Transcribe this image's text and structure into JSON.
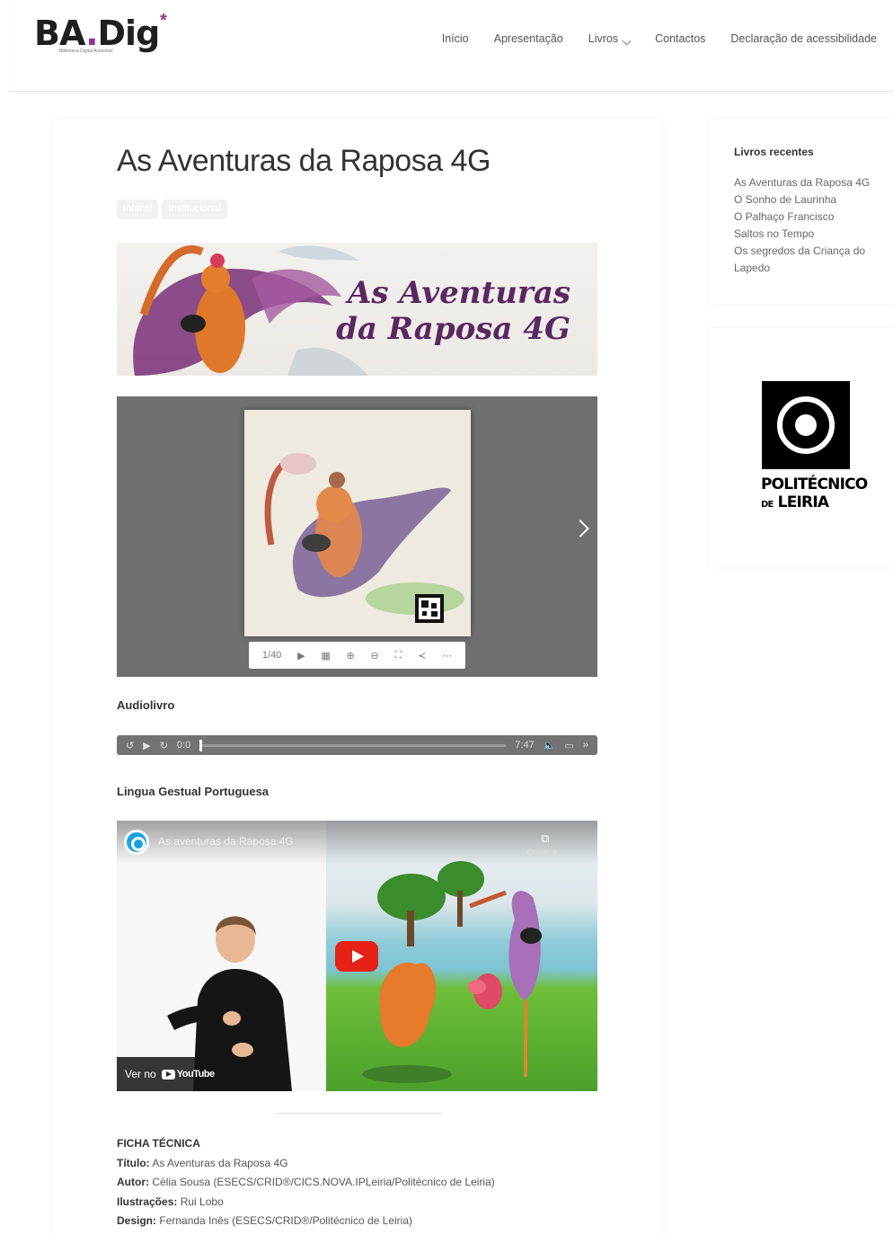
{
  "header": {
    "logo_text_main": "BA",
    "logo_text_dot": ".",
    "logo_text_end": "Dig",
    "logo_star": "*",
    "logo_subtitle": "Biblioteca Digital Acessível",
    "nav": [
      {
        "label": "Início"
      },
      {
        "label": "Apresentação"
      },
      {
        "label": "Livros"
      },
      {
        "label": "Contactos"
      },
      {
        "label": "Declaração de acessibilidade"
      }
    ]
  },
  "main": {
    "title": "As Aventuras da Raposa 4G",
    "tags": [
      "Infantil",
      "Institucional"
    ],
    "banner_title_line1": "As Aventuras",
    "banner_title_line2": "da Raposa 4G",
    "flipbook": {
      "page_indicator": "1/40",
      "icons": [
        "play-icon",
        "grid-icon",
        "zoom-in-icon",
        "zoom-out-icon",
        "fullscreen-icon",
        "share-icon",
        "more-icon"
      ]
    },
    "audio_label": "Audiolivro",
    "audio": {
      "current_time": "0:0",
      "duration": "7:47"
    },
    "sign_language_label": "Lingua Gestual Portuguesa",
    "video": {
      "title": "As aventuras da Raposa 4G",
      "copy_label": "Copiar li...",
      "watch_on": "Ver no",
      "youtube": "YouTube"
    },
    "ficha": {
      "heading": "FICHA TÉCNICA",
      "rows": [
        {
          "label": "Título:",
          "value": "As Aventuras da Raposa 4G"
        },
        {
          "label": "Autor:",
          "value": "Célia Sousa (ESECS/CRID®/CICS.NOVA.IPLeiria/Politécnico de Leiria)"
        },
        {
          "label": "Ilustrações:",
          "value": "Rui Lobo"
        },
        {
          "label": "Design:",
          "value": "Fernanda Inês (ESECS/CRID®/Politécnico de Leiria)"
        }
      ]
    }
  },
  "sidebar": {
    "recent_heading": "Livros recentes",
    "recent_books": [
      "As Aventuras da Raposa 4G",
      "O Sonho de Laurinha",
      "O Palhaço Francisco",
      "Saltos no Tempo",
      "Os segredos da Criança do Lapedo"
    ],
    "partner_line1": "POLITÉCNICO",
    "partner_line2_small": "DE",
    "partner_line2": "LEIRIA"
  },
  "colors": {
    "brand_purple": "#9b2f8f",
    "youtube_red": "#e62117"
  }
}
